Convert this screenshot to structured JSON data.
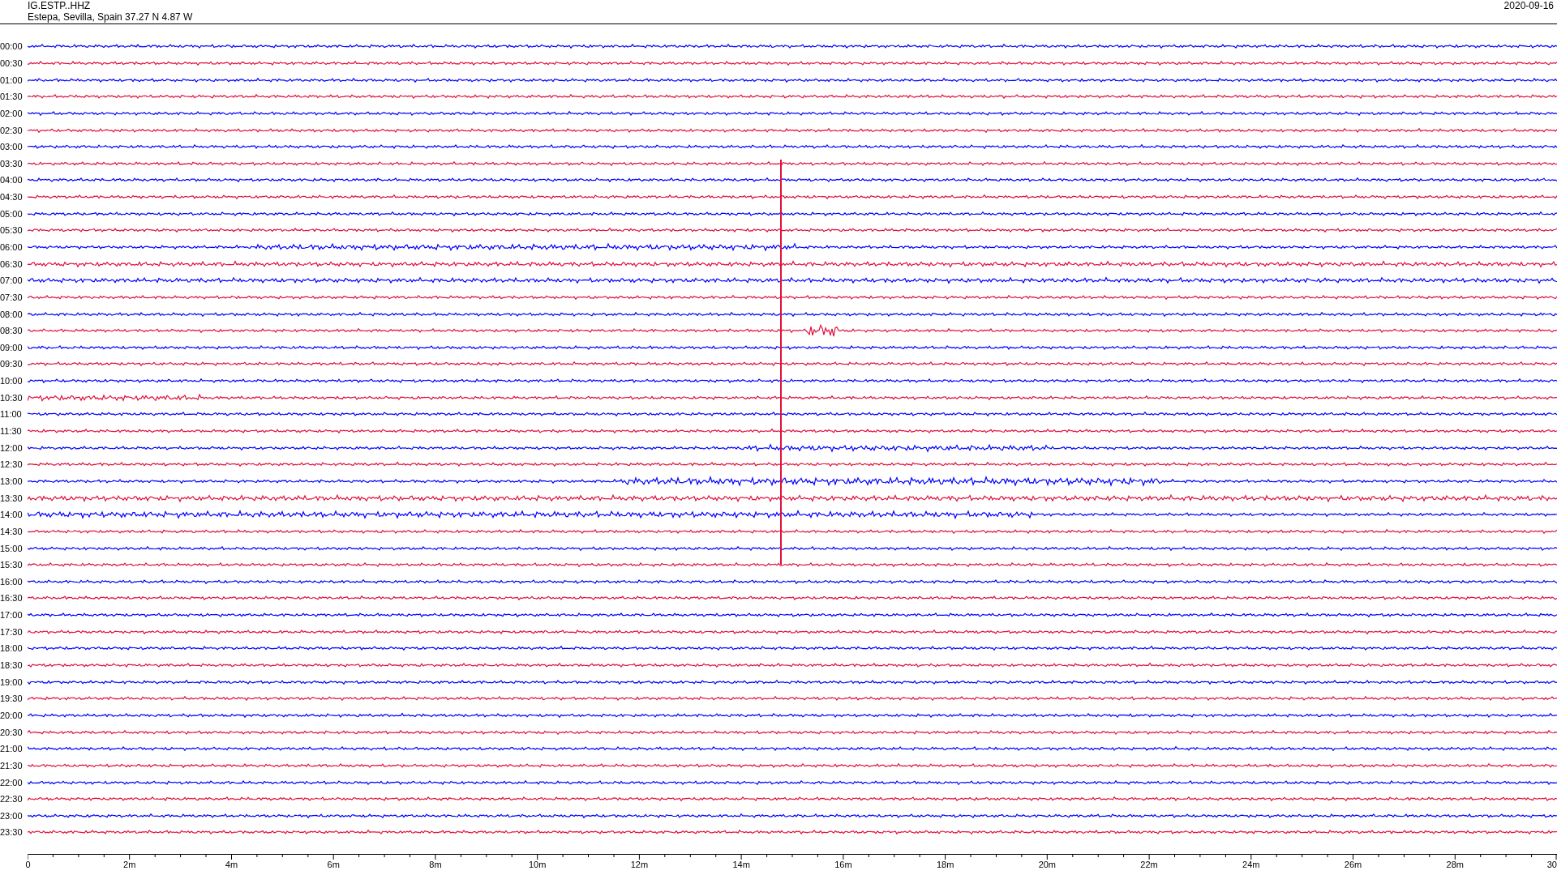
{
  "header": {
    "station": "IG.ESTP..HHZ",
    "location": "Estepa, Sevilla, Spain  37.27 N 4.87 W",
    "date": "2020-09-16"
  },
  "rows": [
    {
      "time": "00:00",
      "color": "#0000ff"
    },
    {
      "time": "00:30",
      "color": "#e0103c"
    },
    {
      "time": "01:00",
      "color": "#0000ff"
    },
    {
      "time": "01:30",
      "color": "#e0103c"
    },
    {
      "time": "02:00",
      "color": "#0000ff"
    },
    {
      "time": "02:30",
      "color": "#e0103c"
    },
    {
      "time": "03:00",
      "color": "#0000ff"
    },
    {
      "time": "03:30",
      "color": "#e0103c"
    },
    {
      "time": "04:00",
      "color": "#0000ff"
    },
    {
      "time": "04:30",
      "color": "#e0103c"
    },
    {
      "time": "05:00",
      "color": "#0000ff"
    },
    {
      "time": "05:30",
      "color": "#e0103c"
    },
    {
      "time": "06:00",
      "color": "#0000ff"
    },
    {
      "time": "06:30",
      "color": "#e0103c"
    },
    {
      "time": "07:00",
      "color": "#0000ff"
    },
    {
      "time": "07:30",
      "color": "#e0103c"
    },
    {
      "time": "08:00",
      "color": "#0000ff"
    },
    {
      "time": "08:30",
      "color": "#e0103c"
    },
    {
      "time": "09:00",
      "color": "#0000ff"
    },
    {
      "time": "09:30",
      "color": "#e0103c"
    },
    {
      "time": "10:00",
      "color": "#0000ff"
    },
    {
      "time": "10:30",
      "color": "#e0103c"
    },
    {
      "time": "11:00",
      "color": "#0000ff"
    },
    {
      "time": "11:30",
      "color": "#e0103c"
    },
    {
      "time": "12:00",
      "color": "#0000ff"
    },
    {
      "time": "12:30",
      "color": "#e0103c"
    },
    {
      "time": "13:00",
      "color": "#0000ff"
    },
    {
      "time": "13:30",
      "color": "#e0103c"
    },
    {
      "time": "14:00",
      "color": "#0000ff"
    },
    {
      "time": "14:30",
      "color": "#e0103c"
    },
    {
      "time": "15:00",
      "color": "#0000ff"
    },
    {
      "time": "15:30",
      "color": "#e0103c"
    },
    {
      "time": "16:00",
      "color": "#0000ff"
    },
    {
      "time": "16:30",
      "color": "#e0103c"
    },
    {
      "time": "17:00",
      "color": "#0000ff"
    },
    {
      "time": "17:30",
      "color": "#e0103c"
    },
    {
      "time": "18:00",
      "color": "#0000ff"
    },
    {
      "time": "18:30",
      "color": "#e0103c"
    },
    {
      "time": "19:00",
      "color": "#0000ff"
    },
    {
      "time": "19:30",
      "color": "#e0103c"
    },
    {
      "time": "20:00",
      "color": "#0000ff"
    },
    {
      "time": "20:30",
      "color": "#e0103c"
    },
    {
      "time": "21:00",
      "color": "#0000ff"
    },
    {
      "time": "21:30",
      "color": "#e0103c"
    },
    {
      "time": "22:00",
      "color": "#0000ff"
    },
    {
      "time": "22:30",
      "color": "#e0103c"
    },
    {
      "time": "23:00",
      "color": "#0000ff"
    },
    {
      "time": "23:30",
      "color": "#e0103c"
    }
  ],
  "x_axis": {
    "ticks": [
      "0",
      "2m",
      "4m",
      "6m",
      "8m",
      "10m",
      "12m",
      "14m",
      "16m",
      "18m",
      "20m",
      "22m",
      "24m",
      "26m",
      "28m",
      "30"
    ]
  }
}
